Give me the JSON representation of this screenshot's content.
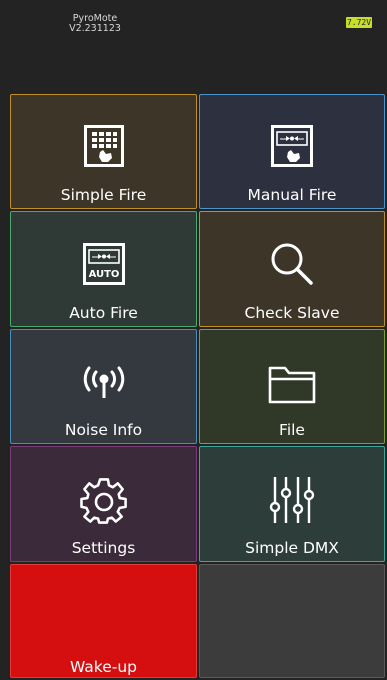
{
  "header": {
    "app_name": "PyroMote",
    "version": "V2.231123",
    "battery": "7.72V"
  },
  "tiles": [
    {
      "label": "Simple Fire",
      "icon": "keypad-fire-icon",
      "bg": "#3d3628",
      "border": "#c08f28"
    },
    {
      "label": "Manual Fire",
      "icon": "manual-fire-icon",
      "bg": "#2d303e",
      "border": "#4a94c9"
    },
    {
      "label": "Auto Fire",
      "icon": "auto-fire-icon",
      "bg": "#2f3936",
      "border": "#4aaa6e"
    },
    {
      "label": "Check Slave",
      "icon": "search-icon",
      "bg": "#3d3628",
      "border": "#c08f28"
    },
    {
      "label": "Noise Info",
      "icon": "signal-icon",
      "bg": "#33393f",
      "border": "#4a8dbb"
    },
    {
      "label": "File",
      "icon": "folder-icon",
      "bg": "#303927",
      "border": "#7aa132"
    },
    {
      "label": "Settings",
      "icon": "gear-icon",
      "bg": "#3b2a39",
      "border": "#7a3c7a"
    },
    {
      "label": "Simple DMX",
      "icon": "sliders-icon",
      "bg": "#2d3e3a",
      "border": "#3aa89a"
    },
    {
      "label": "Wake-up",
      "icon": "",
      "bg": "#d50e10",
      "border": "#e33a3a"
    },
    {
      "label": "",
      "icon": "",
      "bg": "#3c3c3c",
      "border": "#5a5a5a"
    }
  ]
}
